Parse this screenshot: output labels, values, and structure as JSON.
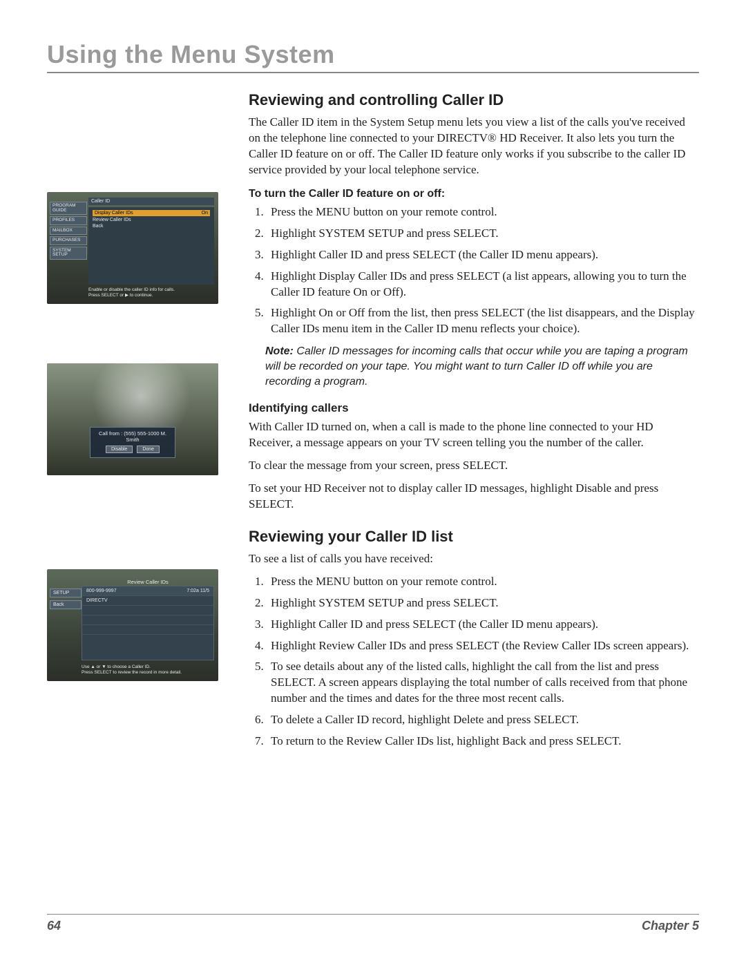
{
  "chapter_title": "Using the Menu System",
  "section1": {
    "heading": "Reviewing and controlling Caller ID",
    "intro": "The Caller ID item in the System Setup menu lets you view a list of the calls you've received on the telephone line connected to your DIRECTV® HD Receiver. It also lets you turn the Caller ID feature on or off. The Caller ID feature only works if you subscribe to the caller ID service provided by your local telephone service.",
    "proc_label": "To turn the Caller ID feature on or off:",
    "steps": [
      "Press the MENU button on your remote control.",
      "Highlight SYSTEM SETUP and press SELECT.",
      "Highlight Caller ID and press SELECT (the Caller ID menu appears).",
      "Highlight Display Caller IDs and press SELECT (a list appears, allowing you to turn the Caller ID feature On or Off).",
      "Highlight On or Off from the list, then press SELECT (the list disappears, and the Display Caller IDs menu item in the Caller ID menu reflects your choice)."
    ],
    "note_label": "Note:",
    "note_text": " Caller ID messages for incoming calls that occur while you are taping a program will be recorded on your tape. You might want to turn Caller ID off while you are recording a program."
  },
  "sub1": {
    "heading": "Identifying callers",
    "para1": "With Caller ID turned on, when a call is made to the phone line connected to your HD Receiver, a message appears on your TV screen telling you the number of the caller.",
    "para2": "To clear the message from your screen, press SELECT.",
    "para3": "To set your HD Receiver not to display caller ID messages, highlight Disable and press SELECT."
  },
  "section2": {
    "heading": "Reviewing your Caller ID list",
    "intro": "To see a list of calls you have received:",
    "steps": [
      "Press the MENU button on your remote control.",
      "Highlight SYSTEM SETUP and press SELECT.",
      "Highlight Caller ID and press SELECT (the Caller ID menu appears).",
      "Highlight Review Caller IDs and press SELECT (the Review Caller IDs screen appears).",
      "To see details about any of the listed calls, highlight the call from the list and press SELECT. A screen appears displaying the total number of calls received from that phone number and the times and dates for the three most recent calls.",
      "To delete a Caller ID record, highlight Delete and press SELECT.",
      "To return to the Review Caller IDs list, highlight Back and press SELECT."
    ]
  },
  "footer": {
    "page": "64",
    "chapter": "Chapter 5"
  },
  "screen1": {
    "title": "Caller ID",
    "tabs": [
      "PROGRAM GUIDE",
      "PROFILES",
      "MAILBOX",
      "PURCHASES",
      "SYSTEM SETUP"
    ],
    "row_hl_left": "Display Caller IDs",
    "row_hl_right": "On",
    "row2": "Review Caller IDs",
    "row3": "Back",
    "hint1": "Enable or disable the caller ID info for calls.",
    "hint2": "Press SELECT or ▶ to continue."
  },
  "screen2": {
    "msg": "Call from : (555) 555-1000   M. Smith",
    "btn_disable": "Disable",
    "btn_done": "Done"
  },
  "screen3": {
    "title": "Review Caller IDs",
    "tab_setup": "SETUP",
    "tab_back": "Back",
    "row_num": "800-999-9997",
    "row_time": "7:02a 11/5",
    "row_name": "DIRECTV",
    "hint1": "Use ▲ or ▼ to choose a Caller ID.",
    "hint2": "Press SELECT to review the record in more detail."
  }
}
